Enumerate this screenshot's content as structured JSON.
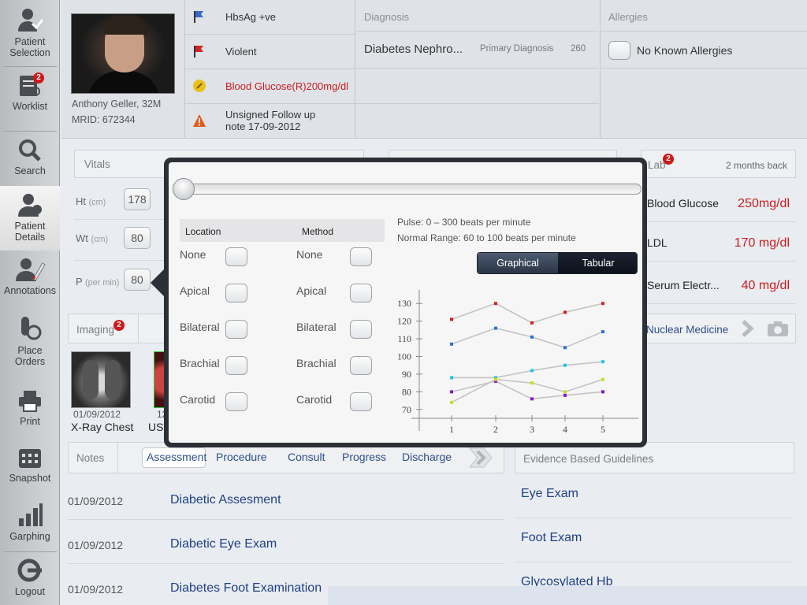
{
  "sidebar": {
    "items": [
      {
        "label": "Patient\nSelection",
        "icon": "patient-selection-icon"
      },
      {
        "label": "Worklist",
        "icon": "worklist-icon",
        "badge": "2"
      },
      {
        "label": "Search",
        "icon": "search-icon"
      },
      {
        "label": "Patient\nDetails",
        "icon": "patient-details-icon"
      },
      {
        "label": "Annotations",
        "icon": "annotations-icon"
      },
      {
        "label": "Place\nOrders",
        "icon": "place-orders-icon"
      },
      {
        "label": "Print",
        "icon": "print-icon"
      },
      {
        "label": "Snapshot",
        "icon": "snapshot-icon"
      },
      {
        "label": "Garphing",
        "icon": "graphing-icon"
      },
      {
        "label": "Logout",
        "icon": "logout-icon"
      }
    ]
  },
  "patient": {
    "name_age": "Anthony Geller, 32M",
    "mrid": "MRID: 672344"
  },
  "alerts": [
    {
      "text": "HbsAg +ve",
      "color": "#222222"
    },
    {
      "text": "Violent",
      "color": "#222222"
    },
    {
      "text": "Blood Glucose(R)200mg/dl",
      "color": "#cc1b1b"
    },
    {
      "text": "Unsigned Follow up\nnote 17-09-2012",
      "color": "#222222"
    }
  ],
  "diagnosis": {
    "header": "Diagnosis",
    "name": "Diabetes Nephro...",
    "type": "Primary Diagnosis",
    "code": "260"
  },
  "allergies": {
    "header": "Allergies",
    "text": "No Known Allergies"
  },
  "vitals": {
    "title": "Vitals",
    "ht_label": "Ht",
    "ht_unit": "(cm)",
    "ht_value": "178",
    "wt_label": "Wt",
    "wt_unit": "(cm)",
    "wt_value": "80",
    "p_label": "P",
    "p_unit": "(per min)",
    "p_value": "80"
  },
  "lab": {
    "title": "Lab",
    "badge": "2",
    "range": "2 months back",
    "rows": [
      {
        "name": "Blood Glucose",
        "value": "250mg/dl"
      },
      {
        "name": "LDL",
        "value": "170 mg/dl"
      },
      {
        "name": "Serum Electr...",
        "value": "40 mg/dl"
      }
    ]
  },
  "imaging": {
    "title": "Imaging",
    "badge": "2",
    "nuclear": "Nuclear Medicine",
    "items": [
      {
        "date": "01/09/2012",
        "label": "X-Ray Chest"
      },
      {
        "date": "12",
        "label": "US"
      }
    ]
  },
  "notes": {
    "title": "Notes",
    "tabs": [
      "Assessment",
      "Procedure",
      "Consult",
      "Progress",
      "Discharge"
    ],
    "rows": [
      {
        "date": "01/09/2012",
        "title": "Diabetic Assesment"
      },
      {
        "date": "01/09/2012",
        "title": "Diabetic Eye Exam"
      },
      {
        "date": "01/09/2012",
        "title": "Diabetes Foot Examination"
      }
    ]
  },
  "guidelines": {
    "title": "Evidence Based Guidelines",
    "items": [
      "Eye Exam",
      "Foot Exam",
      "Glycosylated Hb"
    ]
  },
  "popover": {
    "location_header": "Location",
    "method_header": "Method",
    "locations": [
      "None",
      "Apical",
      "Bilateral",
      "Brachial",
      "Carotid"
    ],
    "methods": [
      "None",
      "Apical",
      "Bilateral",
      "Brachial",
      "Carotid"
    ],
    "pulse_info": "Pulse: 0 – 300 beats per minute",
    "normal_range": "Normal Range: 60 to 100 beats per minute",
    "view_graphical": "Graphical",
    "view_tabular": "Tabular",
    "selected_view": "Graphical",
    "slider_value": 0
  },
  "chart_data": {
    "type": "line",
    "x": [
      1,
      2,
      3,
      4,
      5
    ],
    "yticks": [
      70,
      80,
      90,
      100,
      110,
      120,
      130
    ],
    "ylim": [
      65,
      135
    ],
    "series": [
      {
        "color": "#d62020",
        "values": [
          121,
          130,
          119,
          125,
          130
        ]
      },
      {
        "color": "#2a6fd6",
        "values": [
          107,
          116,
          111,
          105,
          114
        ]
      },
      {
        "color": "#22c3e6",
        "values": [
          88,
          88,
          92,
          95,
          97
        ]
      },
      {
        "color": "#8a16c7",
        "values": [
          80,
          86,
          76,
          78,
          80
        ]
      },
      {
        "color": "#c7e020",
        "values": [
          74,
          87,
          85,
          80,
          87
        ]
      }
    ]
  }
}
